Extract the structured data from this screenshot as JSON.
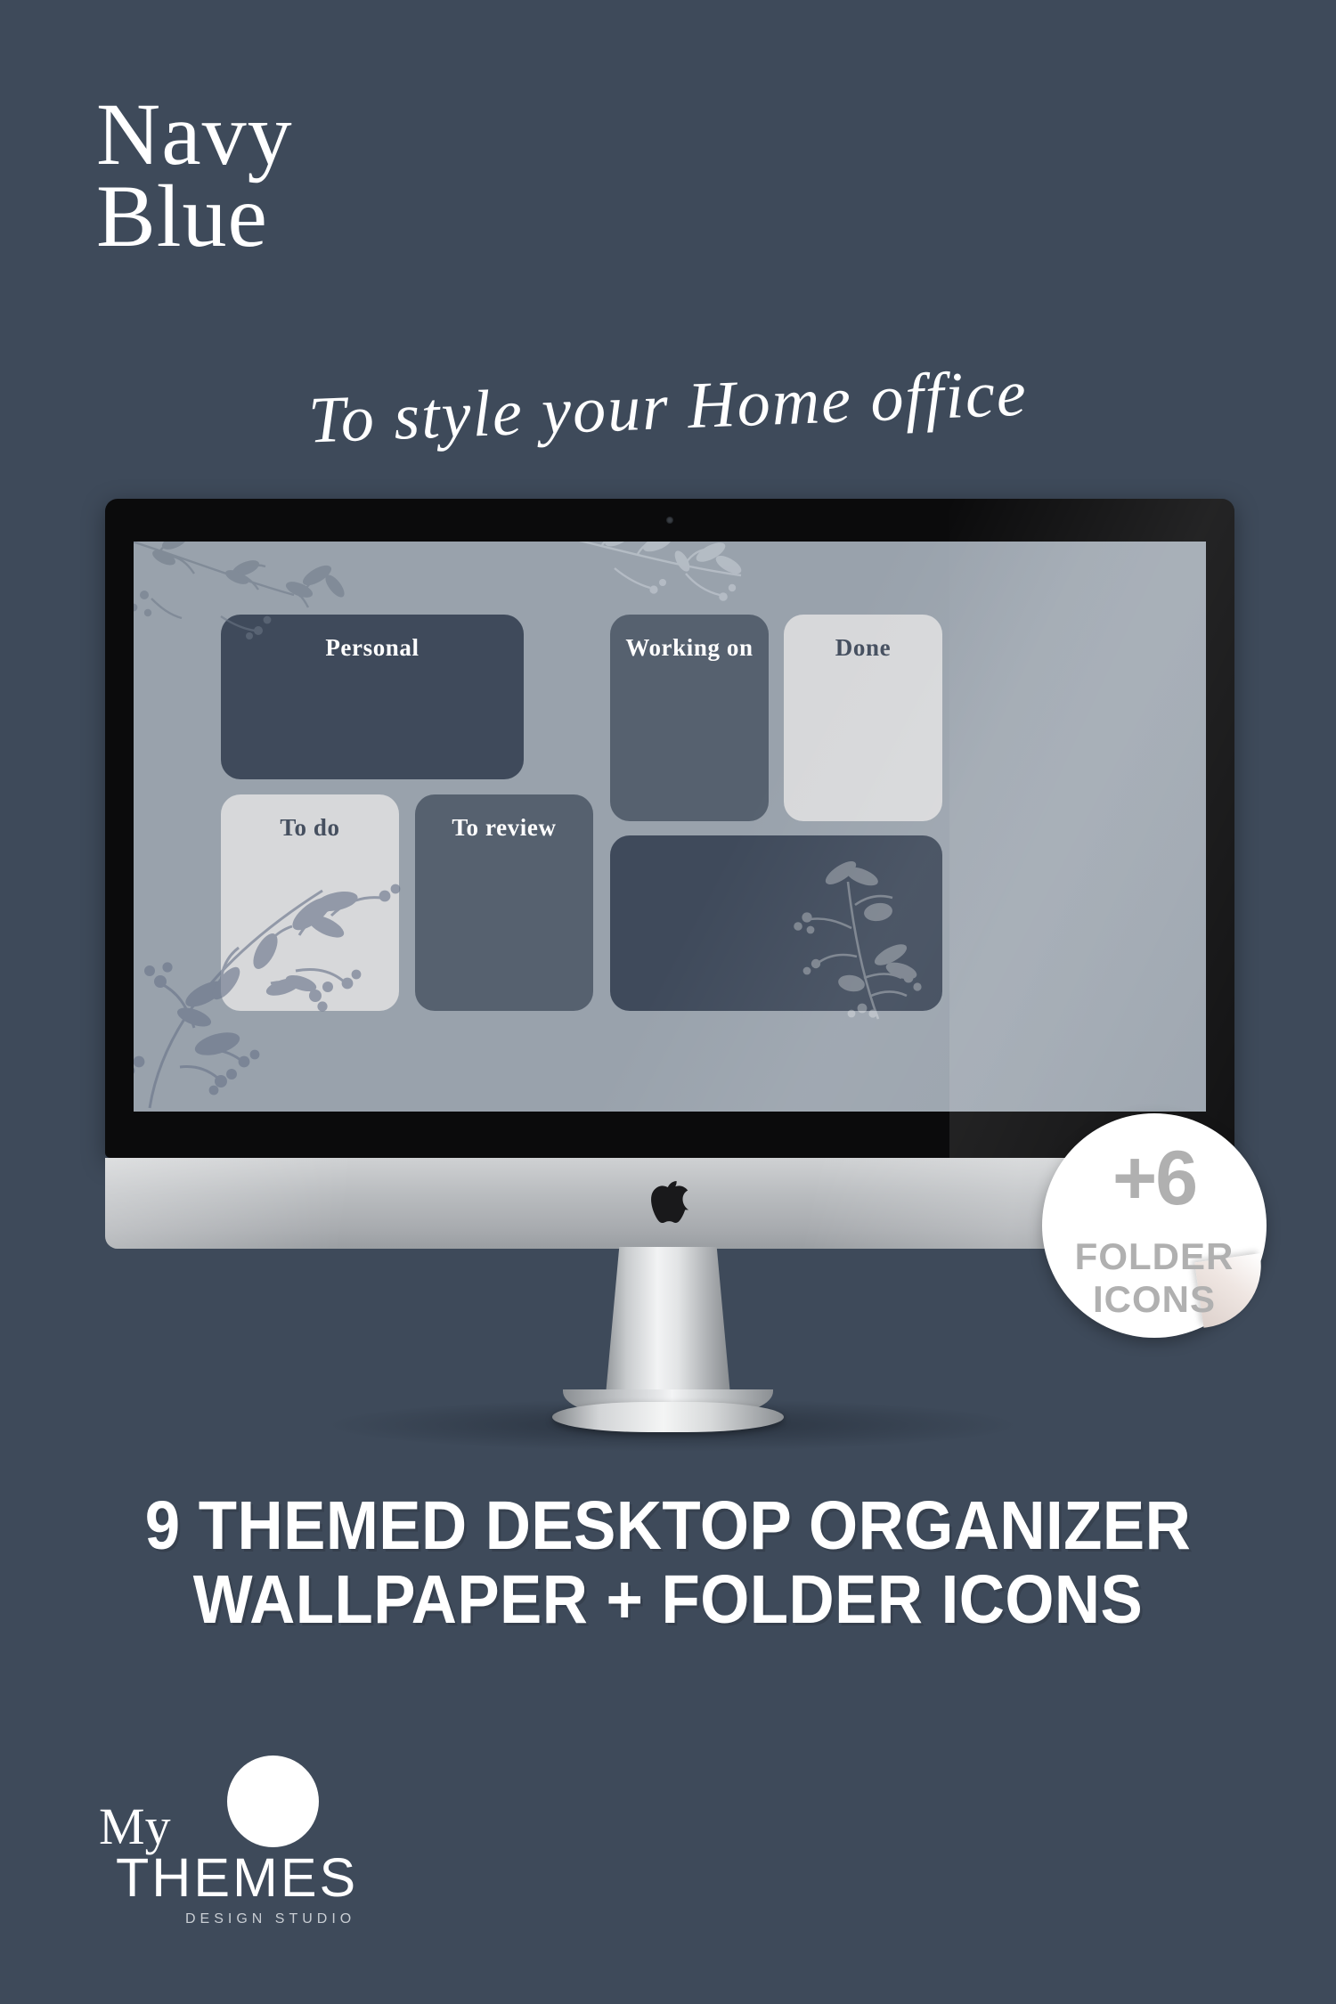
{
  "background_color": "#3e4a5a",
  "header": {
    "brand_title": "Navy\nBlue",
    "tagline": "To style your Home office"
  },
  "monitor": {
    "device": "imac-desktop-computer",
    "apple_logo": "apple-logo-icon",
    "wallpaper": {
      "background_color": "#99a2ac",
      "decorations": [
        "floral-branch-top-left",
        "floral-branch-top-center",
        "floral-branch-bottom-left",
        "floral-branch-bottom-right"
      ],
      "folders": [
        {
          "id": "personal",
          "label": "Personal",
          "fill": "#3f4a5b",
          "text_color": "#ffffff"
        },
        {
          "id": "to-do",
          "label": "To do",
          "fill": "#d7d8da",
          "text_color": "#454f5f"
        },
        {
          "id": "to-review",
          "label": "To review",
          "fill": "#56616f",
          "text_color": "#ffffff"
        },
        {
          "id": "working-on",
          "label": "Working on",
          "fill": "#56616f",
          "text_color": "#ffffff"
        },
        {
          "id": "done",
          "label": "Done",
          "fill": "#d7d8da",
          "text_color": "#454f5f"
        },
        {
          "id": "untitled-wide",
          "label": "",
          "fill": "#3f4a5b",
          "text_color": "#ffffff"
        }
      ]
    }
  },
  "badge": {
    "count": "+6",
    "line1": "FOLDER",
    "line2": "ICONS",
    "color": "#b0b0b0",
    "shape": "round-sticker-with-curled-corner"
  },
  "headline": "9 THEMED DESKTOP ORGANIZER\nWALLPAPER + FOLDER ICONS",
  "logo": {
    "word_my": "My",
    "word_themes": "THEMES",
    "tagline": "DESIGN  STUDIO",
    "mark": "white-circle-logo-mark"
  }
}
